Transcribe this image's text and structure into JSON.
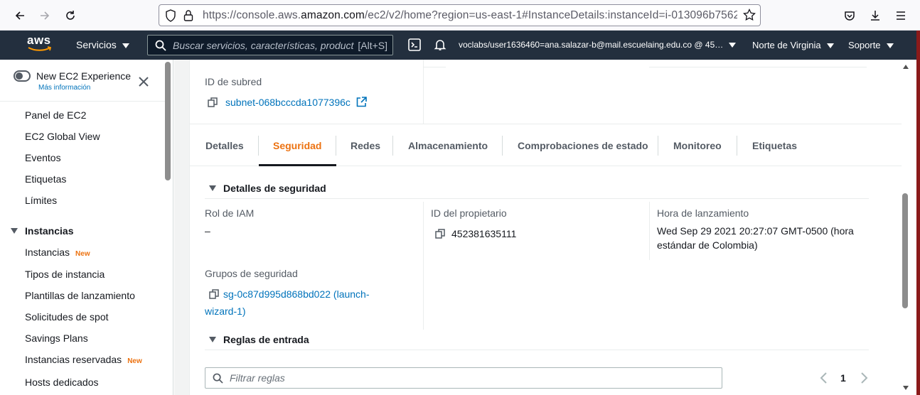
{
  "browser": {
    "url_prefix": "https://console.aws.",
    "url_domain": "amazon.com",
    "url_suffix": "/ec2/v2/home?region=us-east-1#InstanceDetails:instanceId=i-013096b7562"
  },
  "aws_nav": {
    "logo": "aws",
    "services_label": "Servicios",
    "search_placeholder": "Buscar servicios, características, product",
    "search_shortcut": "[Alt+S]",
    "account_label": "voclabs/user1636460=ana.salazar-b@mail.escuelaing.edu.co @ 45…",
    "region_label": "Norte de Virginia",
    "support_label": "Soporte"
  },
  "sidebar": {
    "new_experience_label": "New EC2 Experience",
    "more_info": "Más información",
    "items": [
      {
        "label": "Panel de EC2"
      },
      {
        "label": "EC2 Global View"
      },
      {
        "label": "Eventos"
      },
      {
        "label": "Etiquetas"
      },
      {
        "label": "Límites"
      }
    ],
    "group_instances": "Instancias",
    "instance_items": [
      {
        "label": "Instancias",
        "badge": "New"
      },
      {
        "label": "Tipos de instancia"
      },
      {
        "label": "Plantillas de lanzamiento"
      },
      {
        "label": "Solicitudes de spot"
      },
      {
        "label": "Savings Plans"
      },
      {
        "label": "Instancias reservadas",
        "badge": "New"
      },
      {
        "label": "Hosts dedicados"
      }
    ]
  },
  "details": {
    "subnet_label": "ID de subred",
    "subnet_value": "subnet-068bcccda1077396c"
  },
  "tabs": [
    {
      "label": "Detalles"
    },
    {
      "label": "Seguridad",
      "active": true
    },
    {
      "label": "Redes"
    },
    {
      "label": "Almacenamiento"
    },
    {
      "label": "Comprobaciones de estado"
    },
    {
      "label": "Monitoreo"
    },
    {
      "label": "Etiquetas"
    }
  ],
  "security": {
    "section_title": "Detalles de seguridad",
    "iam_role_label": "Rol de IAM",
    "iam_role_value": "–",
    "owner_label": "ID del propietario",
    "owner_value": "452381635111",
    "launch_label": "Hora de lanzamiento",
    "launch_value_line1": "Wed Sep 29 2021 20:27:07 GMT-0500 (hora",
    "launch_value_line2": "estándar de Colombia)",
    "groups_label": "Grupos de seguridad",
    "groups_value_line1": "sg-0c87d995d868bd022 (launch-",
    "groups_value_line2": "wizard-1)",
    "inbound_title": "Reglas de entrada",
    "filter_placeholder": "Filtrar reglas",
    "page_number": "1"
  },
  "colors": {
    "accent": "#ec7211",
    "link": "#0073bb",
    "nav_bg": "#232f3e"
  }
}
